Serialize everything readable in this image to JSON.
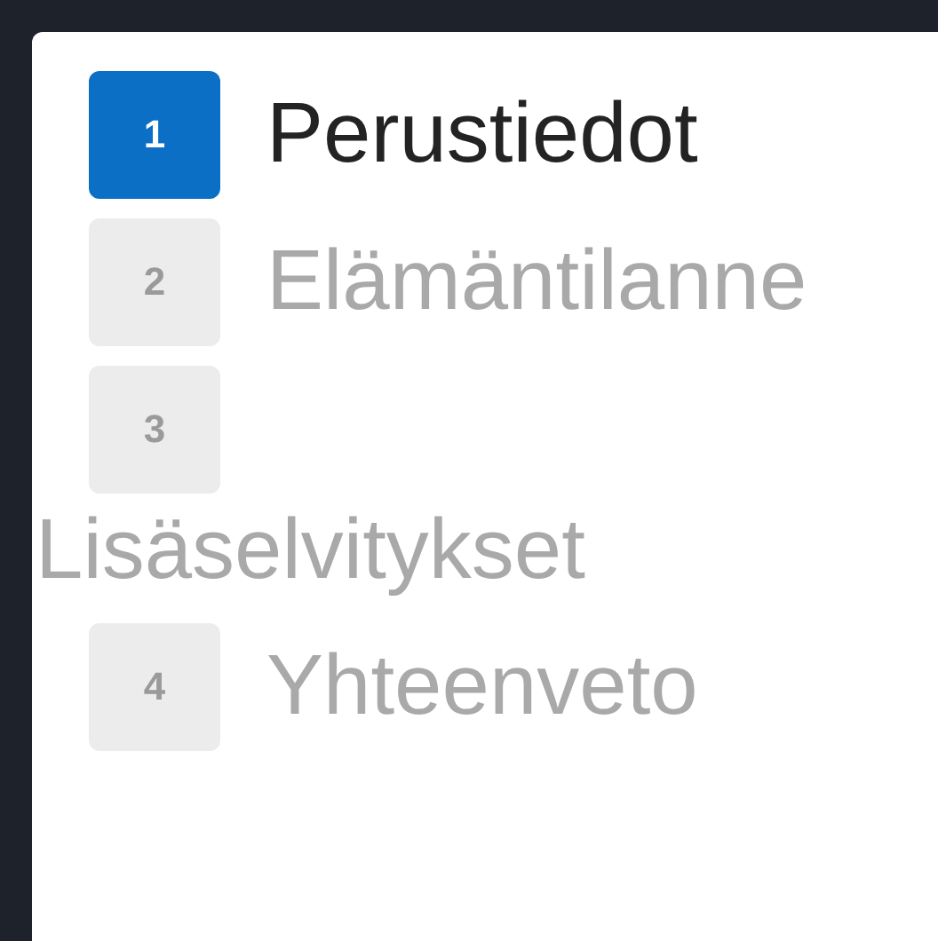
{
  "steps": [
    {
      "number": "1",
      "label": "Perustiedot",
      "selected": true
    },
    {
      "number": "2",
      "label": "Elämäntilanne",
      "selected": false
    },
    {
      "number": "3",
      "label": "Lisäselvitykset",
      "selected": false
    },
    {
      "number": "4",
      "label": "Yhteenveto",
      "selected": false
    }
  ]
}
